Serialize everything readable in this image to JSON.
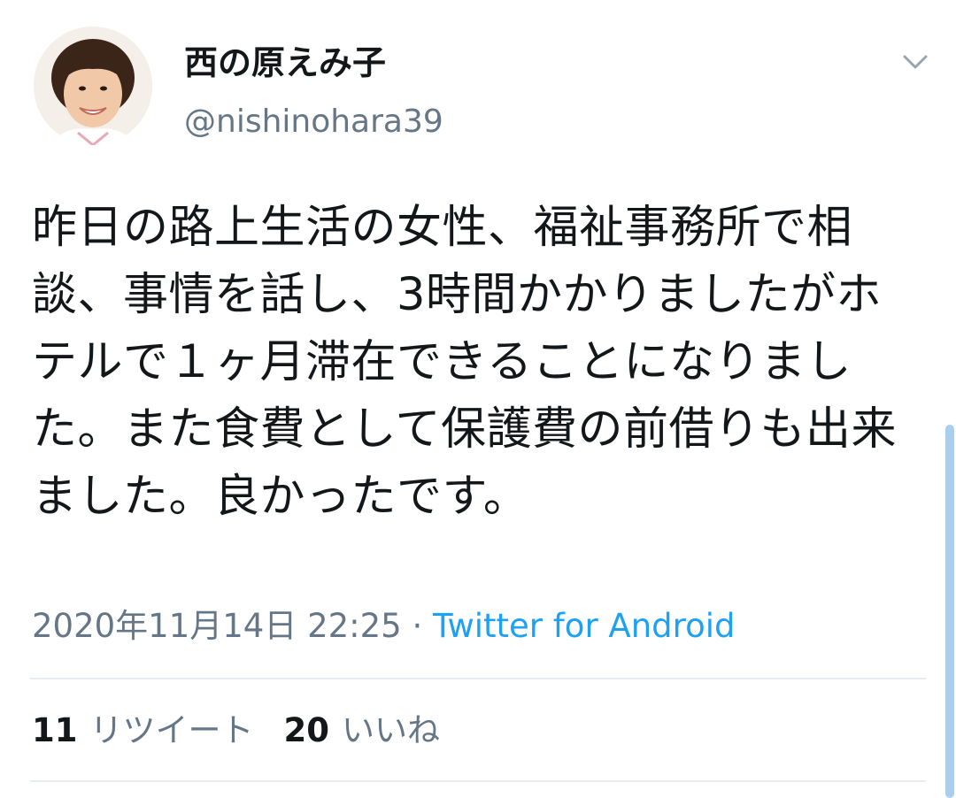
{
  "header": {
    "display_name": "西の原えみ子",
    "handle": "@nishinohara39",
    "menu_icon": "chevron-down-icon"
  },
  "tweet": {
    "text": "昨日の路上生活の女性、福祉事務所で相談、事情を話し、3時間かかりましたがホテルで１ヶ月滞在できることになりました。また食費として保護費の前借りも出来ました。良かったです。",
    "timestamp": "2020年11月14日 22:25",
    "separator": " · ",
    "source": "Twitter for Android"
  },
  "stats": {
    "retweets_count": "11",
    "retweets_label": "リツイート",
    "likes_count": "20",
    "likes_label": "いいね"
  },
  "colors": {
    "text": "#14171a",
    "secondary": "#657786",
    "link": "#1da1f2",
    "divider": "#e6ecf0"
  }
}
